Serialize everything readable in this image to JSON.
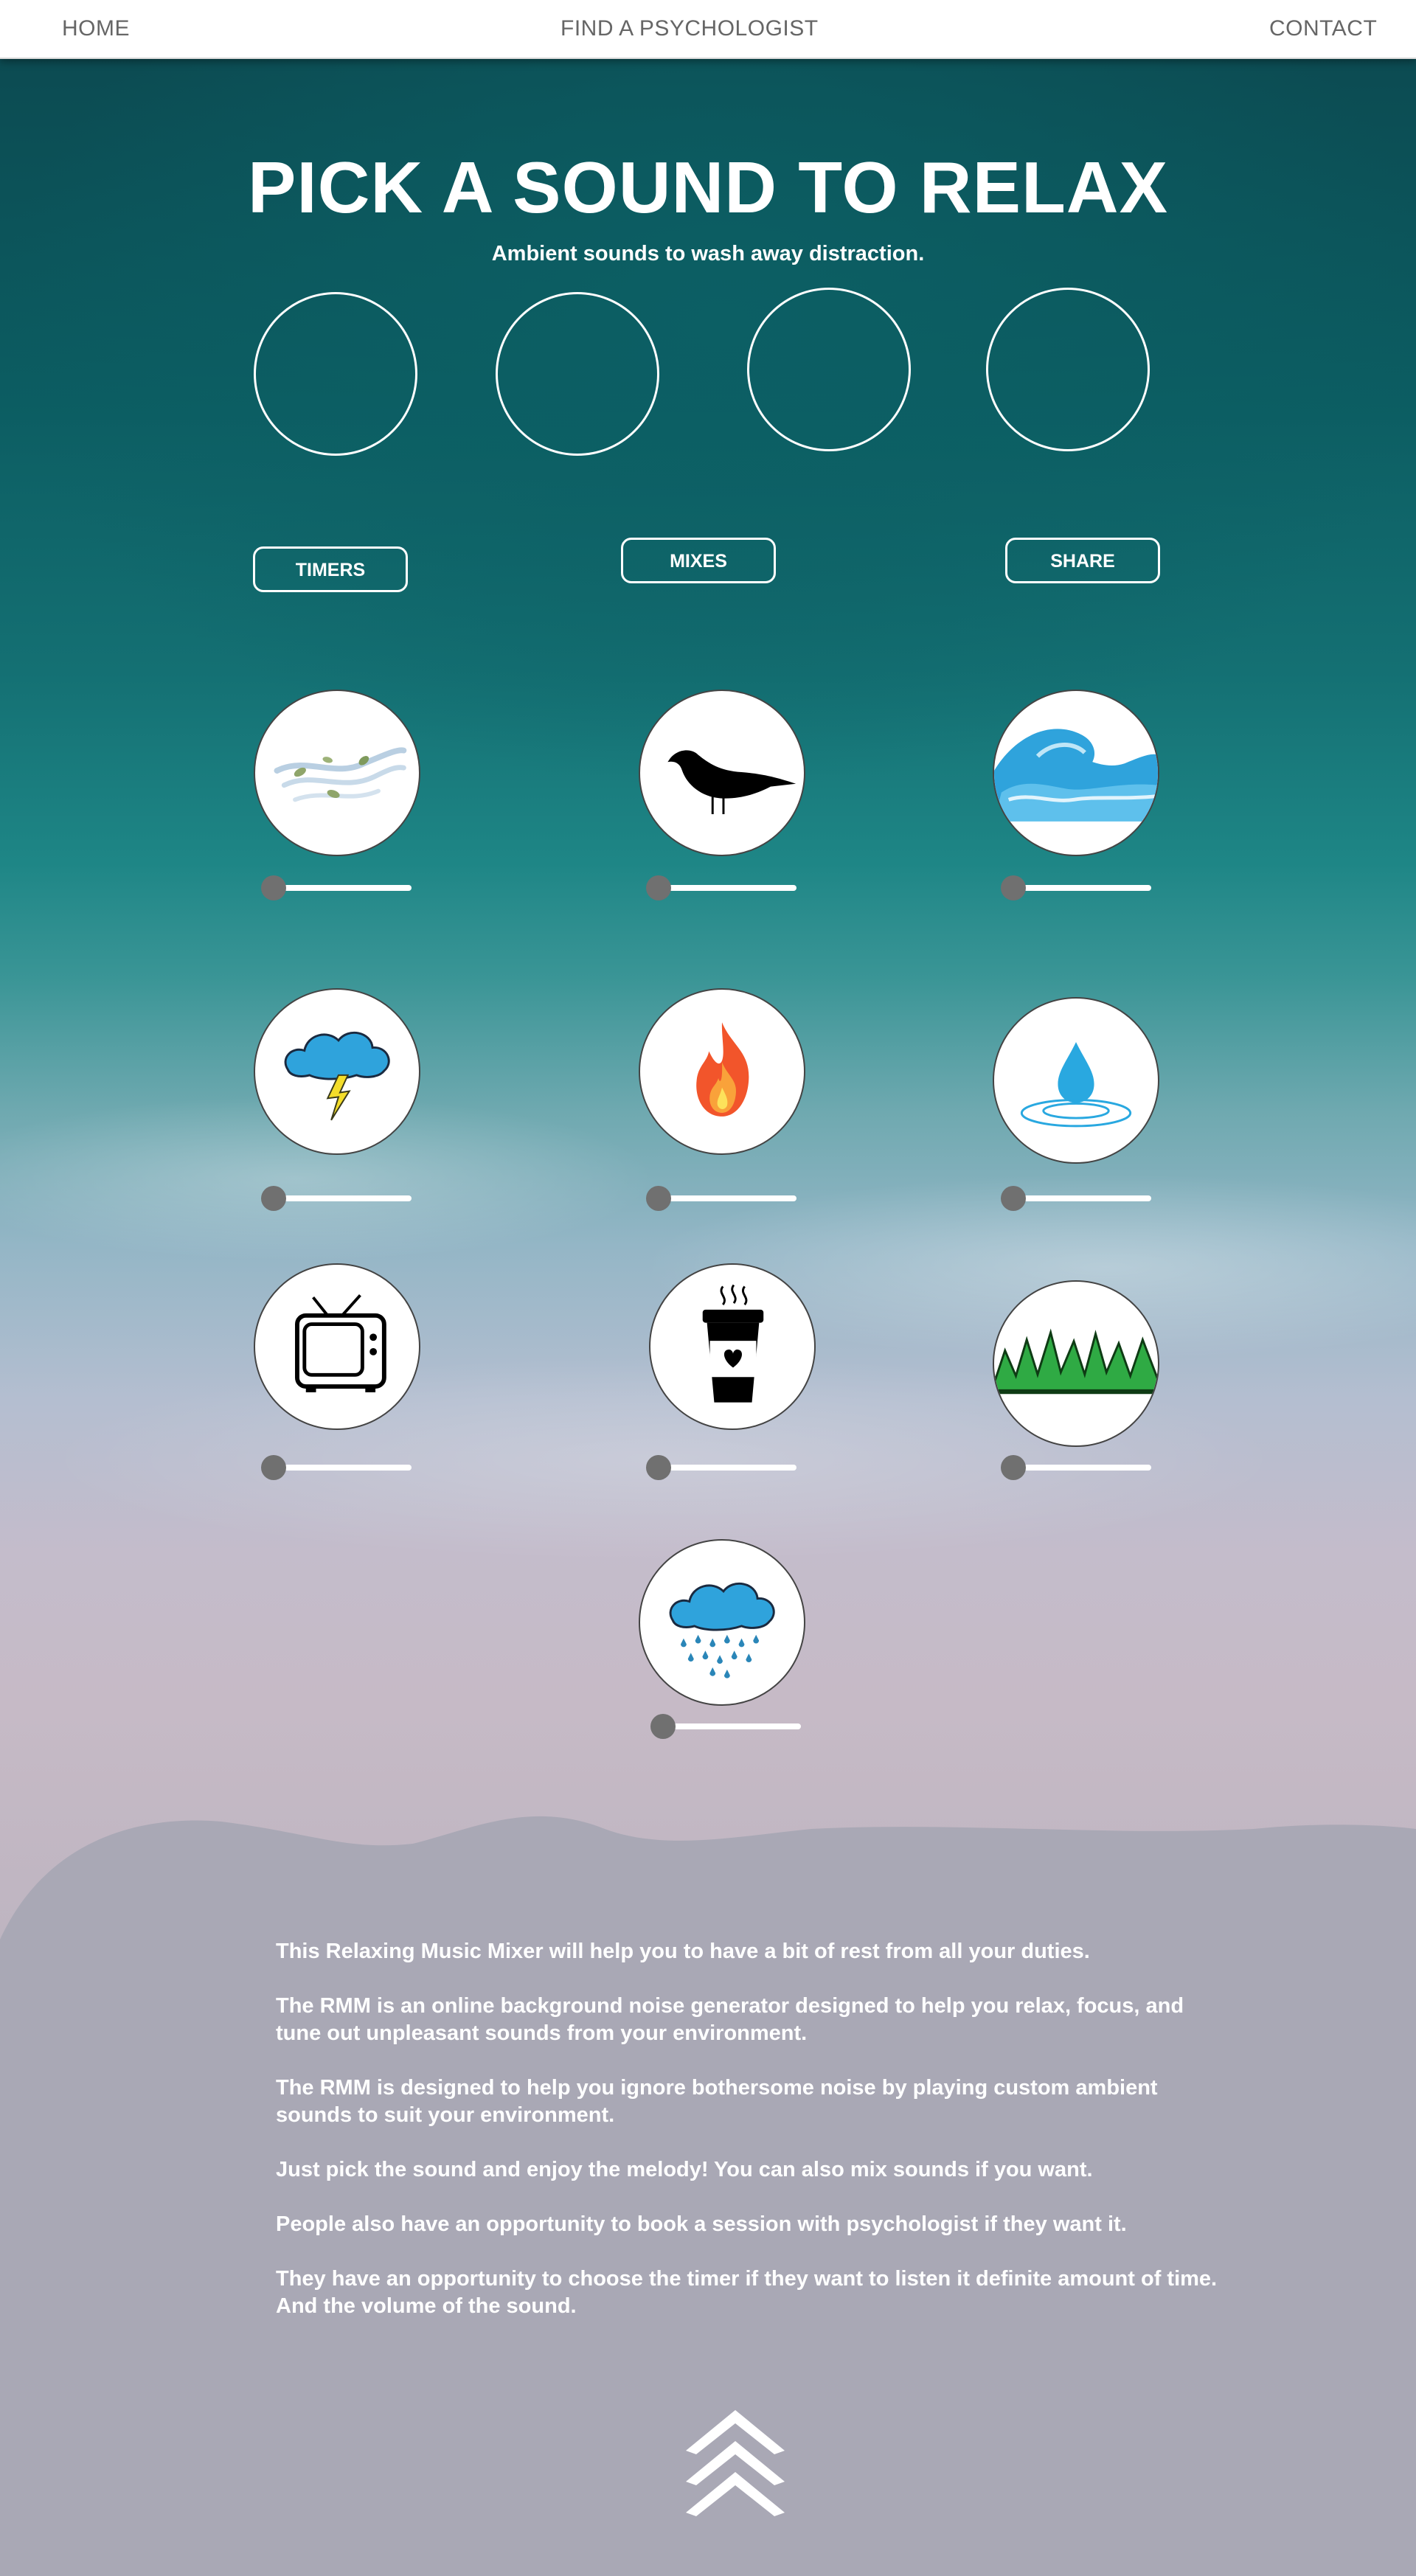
{
  "nav": {
    "home": "HOME",
    "find_psychologist": "FIND A PSYCHOLOGIST",
    "contact": "CONTACT"
  },
  "hero": {
    "title": "PICK A SOUND TO RELAX",
    "subtitle": "Ambient sounds to wash away distraction."
  },
  "buttons": {
    "timers": "TIMERS",
    "mixes": "MIXES",
    "share": "SHARE"
  },
  "sounds": [
    {
      "icon": "wind-icon",
      "volume": 0.05
    },
    {
      "icon": "bird-icon",
      "volume": 0.05
    },
    {
      "icon": "waves-icon",
      "volume": 0.05
    },
    {
      "icon": "thunderstorm-icon",
      "volume": 0.05
    },
    {
      "icon": "fire-icon",
      "volume": 0.05
    },
    {
      "icon": "water-drop-icon",
      "volume": 0.05
    },
    {
      "icon": "tv-icon",
      "volume": 0.05
    },
    {
      "icon": "coffee-cup-icon",
      "volume": 0.05
    },
    {
      "icon": "grass-icon",
      "volume": 0.05
    },
    {
      "icon": "rain-icon",
      "volume": 0.05
    }
  ],
  "about": {
    "p1": "This Relaxing Music Mixer will help you to have a bit of rest from all your duties.",
    "p2": "The RMM is an online background noise generator designed to help you relax, focus, and tune out unpleasant sounds from your environment.",
    "p3": "The RMM is designed to help you ignore bothersome noise by playing custom ambient sounds to suit your environment.",
    "p4": "Just pick the sound and enjoy the melody! You can also mix sounds if you want.",
    "p5": "People also have an opportunity to book a session with psychologist if they want it.",
    "p6": "They have an opportunity to choose the timer if they want to listen it definite amount of time. And the volume of the sound."
  },
  "colors": {
    "nav_bg": "#ffffff",
    "nav_text": "#666666",
    "footer_bg": "#a9a8b5",
    "slider_thumb": "#707070",
    "accent_blue": "#29a8e0"
  }
}
